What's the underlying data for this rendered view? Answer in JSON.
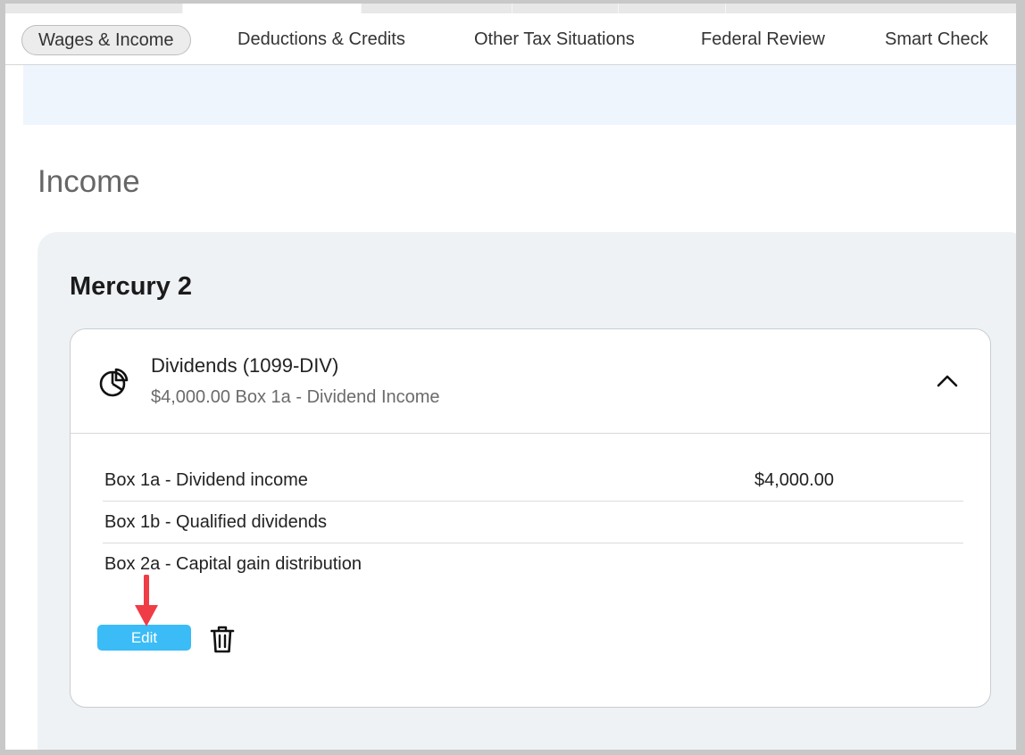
{
  "nav": {
    "tabs": [
      {
        "label": "Wages & Income",
        "active": true
      },
      {
        "label": "Deductions & Credits",
        "active": false
      },
      {
        "label": "Other Tax Situations",
        "active": false
      },
      {
        "label": "Federal Review",
        "active": false
      },
      {
        "label": "Smart Check",
        "active": false
      }
    ]
  },
  "page": {
    "section_title": "Income"
  },
  "account": {
    "institution": "Mercury 2",
    "form": {
      "title": "Dividends (1099-DIV)",
      "summary": "$4,000.00 Box 1a - Dividend Income",
      "icon": "pie-chart-icon",
      "rows": [
        {
          "label": "Box 1a - Dividend income",
          "value": "$4,000.00"
        },
        {
          "label": "Box 1b - Qualified dividends",
          "value": ""
        },
        {
          "label": "Box 2a - Capital gain distribution",
          "value": ""
        }
      ],
      "edit_label": "Edit"
    }
  },
  "colors": {
    "accent": "#3bbcf6",
    "annotation_arrow": "#f03c46",
    "panel_bg": "#eff2f5",
    "band_bg": "#eef5fd"
  }
}
